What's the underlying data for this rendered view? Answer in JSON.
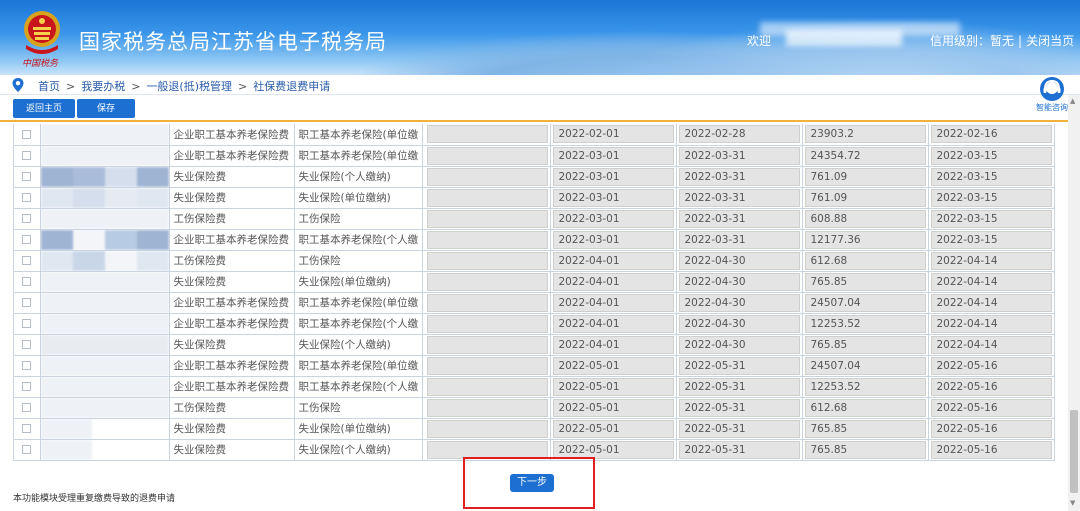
{
  "header": {
    "title": "国家税务总局江苏省电子税务局",
    "emblem_subtitle": "中国税务",
    "welcome": "欢迎",
    "credit_level": "信用级别：暂无",
    "separator": "|",
    "close_page": "关闭当页"
  },
  "breadcrumb": {
    "items": [
      "首页",
      "我要办税",
      "一般退(抵)税管理",
      "社保费退费申请"
    ],
    "separator": ">"
  },
  "toolbar": {
    "home_label": "返回主页",
    "save_label": "保存"
  },
  "assistant": {
    "label": "智能咨询",
    "icon": "headset-icon"
  },
  "table": {
    "rows": [
      {
        "type": "企业职工基本养老保险费",
        "item": "职工基本养老保险(单位缴",
        "start": "2022-02-01",
        "end": "2022-02-28",
        "amount": "23903.2",
        "date": "2022-02-16"
      },
      {
        "type": "企业职工基本养老保险费",
        "item": "职工基本养老保险(单位缴",
        "start": "2022-03-01",
        "end": "2022-03-31",
        "amount": "24354.72",
        "date": "2022-03-15"
      },
      {
        "type": "失业保险费",
        "item": "失业保险(个人缴纳)",
        "start": "2022-03-01",
        "end": "2022-03-31",
        "amount": "761.09",
        "date": "2022-03-15"
      },
      {
        "type": "失业保险费",
        "item": "失业保险(单位缴纳)",
        "start": "2022-03-01",
        "end": "2022-03-31",
        "amount": "761.09",
        "date": "2022-03-15"
      },
      {
        "type": "工伤保险费",
        "item": "工伤保险",
        "start": "2022-03-01",
        "end": "2022-03-31",
        "amount": "608.88",
        "date": "2022-03-15"
      },
      {
        "type": "企业职工基本养老保险费",
        "item": "职工基本养老保险(个人缴",
        "start": "2022-03-01",
        "end": "2022-03-31",
        "amount": "12177.36",
        "date": "2022-03-15"
      },
      {
        "type": "工伤保险费",
        "item": "工伤保险",
        "start": "2022-04-01",
        "end": "2022-04-30",
        "amount": "612.68",
        "date": "2022-04-14"
      },
      {
        "type": "失业保险费",
        "item": "失业保险(单位缴纳)",
        "start": "2022-04-01",
        "end": "2022-04-30",
        "amount": "765.85",
        "date": "2022-04-14"
      },
      {
        "type": "企业职工基本养老保险费",
        "item": "职工基本养老保险(单位缴",
        "start": "2022-04-01",
        "end": "2022-04-30",
        "amount": "24507.04",
        "date": "2022-04-14"
      },
      {
        "type": "企业职工基本养老保险费",
        "item": "职工基本养老保险(个人缴",
        "start": "2022-04-01",
        "end": "2022-04-30",
        "amount": "12253.52",
        "date": "2022-04-14"
      },
      {
        "type": "失业保险费",
        "item": "失业保险(个人缴纳)",
        "start": "2022-04-01",
        "end": "2022-04-30",
        "amount": "765.85",
        "date": "2022-04-14"
      },
      {
        "type": "企业职工基本养老保险费",
        "item": "职工基本养老保险(单位缴",
        "start": "2022-05-01",
        "end": "2022-05-31",
        "amount": "24507.04",
        "date": "2022-05-16"
      },
      {
        "type": "企业职工基本养老保险费",
        "item": "职工基本养老保险(个人缴",
        "start": "2022-05-01",
        "end": "2022-05-31",
        "amount": "12253.52",
        "date": "2022-05-16"
      },
      {
        "type": "工伤保险费",
        "item": "工伤保险",
        "start": "2022-05-01",
        "end": "2022-05-31",
        "amount": "612.68",
        "date": "2022-05-16"
      },
      {
        "type": "失业保险费",
        "item": "失业保险(单位缴纳)",
        "start": "2022-05-01",
        "end": "2022-05-31",
        "amount": "765.85",
        "date": "2022-05-16"
      },
      {
        "type": "失业保险费",
        "item": "失业保险(个人缴纳)",
        "start": "2022-05-01",
        "end": "2022-05-31",
        "amount": "765.85",
        "date": "2022-05-16"
      }
    ]
  },
  "footer": {
    "next_label": "下一步",
    "note": "本功能模块受理重复缴费导致的退费申请"
  },
  "colors": {
    "primary": "#1d6fd1",
    "accent_border": "#f0b23b",
    "highlight": "#e02020"
  }
}
